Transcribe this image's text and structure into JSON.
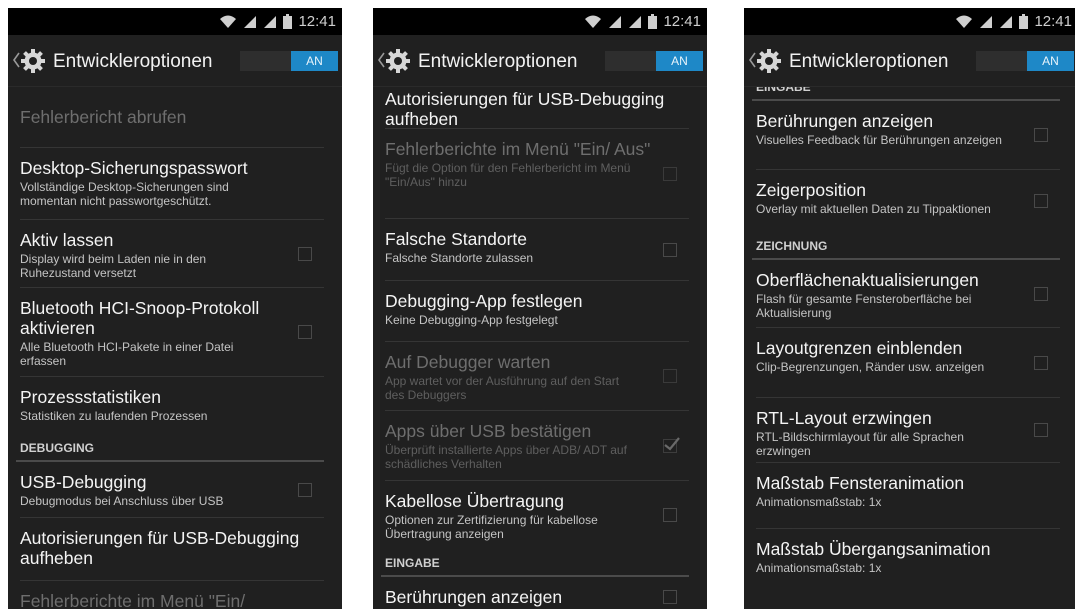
{
  "statusbar": {
    "time": "12:41",
    "signal_icons": [
      "wifi-icon",
      "signal-icon",
      "signal-icon",
      "battery-icon"
    ]
  },
  "actionbar": {
    "title": "Entwickleroptionen",
    "switch_label": "AN",
    "icon": "gear-icon"
  },
  "colors": {
    "background": "#202020",
    "accent": "#1e88c7",
    "statusbar": "#000000"
  },
  "screens": [
    {
      "offset": 0,
      "rows": [
        {
          "kind": "item",
          "title": "Fehlerbericht abrufen",
          "disabled": true,
          "checkbox": false,
          "h": 60,
          "pad": 20
        },
        {
          "kind": "item",
          "title": "Desktop-Sicherungspasswort",
          "summary": "Vollständige Desktop-Sicherungen sind momentan nicht passwortgeschützt.",
          "checkbox": false,
          "h": 71
        },
        {
          "kind": "item",
          "title": "Aktiv lassen",
          "summary": "Display wird beim Laden nie in den Ruhezustand versetzt",
          "checkbox": true,
          "h": 67
        },
        {
          "kind": "item",
          "title": "Bluetooth HCI-Snoop-Protokoll aktivieren",
          "summary": "Alle Bluetooth HCI-Pakete in einer Datei erfassen",
          "checkbox": true,
          "h": 88
        },
        {
          "kind": "item",
          "title": "Prozessstatistiken",
          "summary": "Statistiken zu laufenden Prozessen",
          "checkbox": false,
          "h": 57
        },
        {
          "kind": "section",
          "title": "DEBUGGING"
        },
        {
          "kind": "item",
          "title": "USB-Debugging",
          "summary": "Debugmodus bei Anschluss über USB",
          "checkbox": true,
          "h": 55
        },
        {
          "kind": "item",
          "title": "Autorisierungen für USB-Debugging aufheben",
          "checkbox": false,
          "h": 62
        },
        {
          "kind": "item",
          "title": "Fehlerberichte im Menü \"Ein/",
          "disabled": true,
          "checkbox": false,
          "h": 40
        }
      ]
    },
    {
      "offset": -8,
      "rows": [
        {
          "kind": "item",
          "title": "Autorisierungen für USB-Debugging aufheben",
          "checkbox": false,
          "h": 49
        },
        {
          "kind": "item",
          "title": "Fehlerberichte im Menü \"Ein/ Aus\"",
          "summary": "Fügt die Option für den Fehlerbericht im Menü \"Ein/Aus\" hinzu",
          "disabled": true,
          "checkbox": true,
          "h": 89
        },
        {
          "kind": "item",
          "title": "Falsche Standorte",
          "summary": "Falsche Standorte zulassen",
          "checkbox": true,
          "h": 61
        },
        {
          "kind": "item",
          "title": "Debugging-App festlegen",
          "summary": "Keine Debugging-App festgelegt",
          "checkbox": false,
          "h": 60
        },
        {
          "kind": "item",
          "title": "Auf Debugger warten",
          "summary": "App wartet vor der Ausführung auf den Start des Debuggers",
          "disabled": true,
          "checkbox": true,
          "h": 68
        },
        {
          "kind": "item",
          "title": "Apps über USB bestätigen",
          "summary": "Überprüft installierte Apps über ADB/ ADT auf schädliches Verhalten",
          "disabled": true,
          "checkbox": true,
          "checked": true,
          "h": 69
        },
        {
          "kind": "item",
          "title": "Kabellose Übertragung",
          "summary": "Optionen zur Zertifizierung für kabellose Übertragung anzeigen",
          "checkbox": true,
          "h": 68
        },
        {
          "kind": "section",
          "title": "EINGABE"
        },
        {
          "kind": "item",
          "title": "Berührungen anzeigen",
          "checkbox": true,
          "h": 40
        }
      ]
    },
    {
      "offset": -14,
      "rows": [
        {
          "kind": "section",
          "title": "EINGABE"
        },
        {
          "kind": "item",
          "title": "Berührungen anzeigen",
          "summary": "Visuelles Feedback für Berührungen anzeigen",
          "checkbox": true,
          "h": 68
        },
        {
          "kind": "item",
          "title": "Zeigerposition",
          "summary": "Overlay mit aktuellen Daten zu Tippaktionen",
          "checkbox": true,
          "h": 62
        },
        {
          "kind": "section",
          "title": "ZEICHNUNG"
        },
        {
          "kind": "item",
          "title": "Oberflächenaktualisierungen",
          "summary": "Flash für gesamte Fensteroberfläche bei Aktualisierung",
          "checkbox": true,
          "h": 67
        },
        {
          "kind": "item",
          "title": "Layoutgrenzen einblenden",
          "summary": "Clip-Begrenzungen, Ränder usw. anzeigen",
          "checkbox": true,
          "h": 69
        },
        {
          "kind": "item",
          "title": "RTL-Layout erzwingen",
          "summary": "RTL-Bildschirmlayout für alle Sprachen erzwingen",
          "checkbox": true,
          "h": 64
        },
        {
          "kind": "item",
          "title": "Maßstab Fensteranimation",
          "summary": "Animationsmaßstab: 1x",
          "checkbox": false,
          "h": 65
        },
        {
          "kind": "item",
          "title": "Maßstab Übergangsanimation",
          "summary": "Animationsmaßstab: 1x",
          "checkbox": false,
          "h": 65
        }
      ]
    }
  ]
}
